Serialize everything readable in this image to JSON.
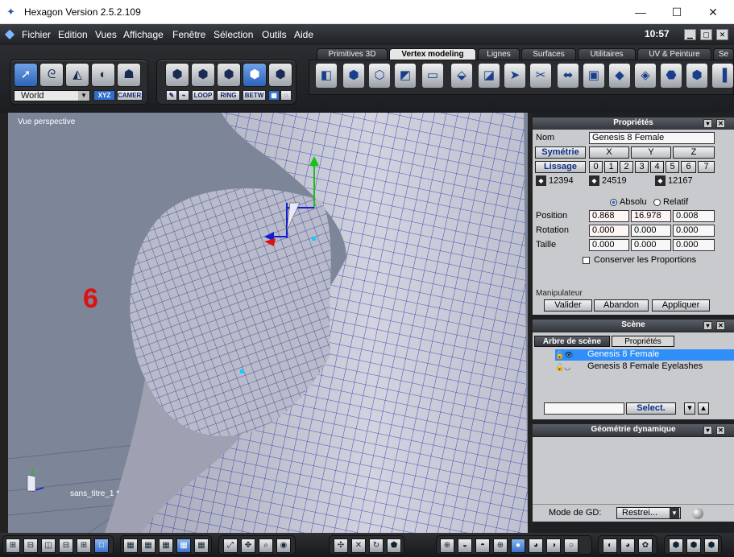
{
  "window": {
    "title": "Hexagon Version 2.5.2.109",
    "minimize": "—",
    "maximize": "☐",
    "close": "✕"
  },
  "menu": {
    "items": [
      "Fichier",
      "Edition",
      "Vues",
      "Affichage",
      "Fenêtre",
      "Sélection",
      "Outils",
      "Aide"
    ],
    "clock": "10:57"
  },
  "toolbar": {
    "world_select": "World",
    "xyz_label": "XYZ",
    "camera_label": "CAMERA",
    "loop_label": "LOOP",
    "ring_label": "RING",
    "betw_label": "BETW"
  },
  "tabs": [
    "Primitives 3D",
    "Vertex modeling",
    "Lignes",
    "Surfaces",
    "Utilitaires",
    "UV & Peinture",
    "Se"
  ],
  "active_tab": "Vertex modeling",
  "viewport": {
    "label": "Vue perspective",
    "annotation_number": "6",
    "filename": "sans_titre_1 *"
  },
  "properties": {
    "title": "Propriétés",
    "name_label": "Nom",
    "name_value": "Genesis 8 Female",
    "symmetry_label": "Symétrie",
    "axes": [
      "X",
      "Y",
      "Z"
    ],
    "smoothing_label": "Lissage",
    "smoothing_levels": [
      "0",
      "1",
      "2",
      "3",
      "4",
      "5",
      "6",
      "7"
    ],
    "counts": [
      "12394",
      "24519",
      "12167"
    ],
    "absolute_label": "Absolu",
    "relative_label": "Relatif",
    "position_label": "Position",
    "position": [
      "0.868",
      "16.978",
      "0.008"
    ],
    "rotation_label": "Rotation",
    "rotation": [
      "0.000",
      "0.000",
      "0.000"
    ],
    "size_label": "Taille",
    "size": [
      "0.000",
      "0.000",
      "0.000"
    ],
    "keep_proportions_label": "Conserver les Proportions",
    "manipulator_label": "Manipulateur",
    "validate_label": "Valider",
    "abandon_label": "Abandon",
    "apply_label": "Appliquer"
  },
  "scene": {
    "title": "Scène",
    "tabs": [
      "Arbre de scène",
      "Propriétés"
    ],
    "items": [
      "Genesis 8 Female",
      "Genesis 8 Female Eyelashes"
    ],
    "select_label": "Select."
  },
  "dynamic_geometry": {
    "title": "Géométrie dynamique",
    "mode_label": "Mode de GD:",
    "mode_value": "Restrei..."
  },
  "colors": {
    "accent": "#2f8ef7",
    "annotation": "#e01010",
    "mesh": "#c8c9d6",
    "wire": "#1c2fa8"
  }
}
